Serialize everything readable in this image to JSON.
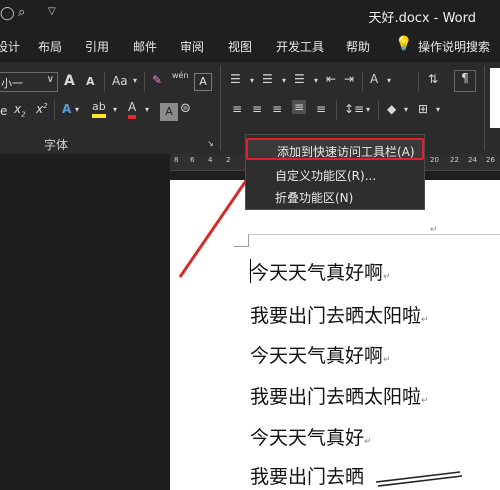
{
  "window": {
    "title": "天好.docx  -  Word"
  },
  "tabs": [
    "设计",
    "布局",
    "引用",
    "邮件",
    "审阅",
    "视图",
    "开发工具",
    "帮助"
  ],
  "tell_me": "操作说明搜索",
  "ribbon": {
    "font_size": "小一",
    "group_font": "字体",
    "btn_grow": "A",
    "btn_shrink": "A",
    "btn_case": "Aa",
    "btn_phonetic": "wén",
    "btn_border_char": "A",
    "btn_subscript": "x",
    "btn_superscript": "x",
    "btn_effects": "A",
    "btn_highlight": "ab",
    "btn_fontcolor": "A",
    "btn_shading": "A",
    "btn_enclose": "字",
    "strike_fragment": "e"
  },
  "ruler_numbers": [
    "8",
    "6",
    "4",
    "2",
    "20",
    "22",
    "24",
    "26"
  ],
  "context_menu": {
    "items": [
      "添加到快速访问工具栏(A)",
      "自定义功能区(R)...",
      "折叠功能区(N)"
    ]
  },
  "document": {
    "lines": [
      "今天天气真好啊",
      "我要出门去晒太阳啦",
      "今天天气真好啊",
      "我要出门去晒太阳啦",
      "今天天气真好",
      "我要出门去晒"
    ]
  },
  "colors": {
    "highlight_border": "#e0202a",
    "arrow": "#d42a2a"
  }
}
